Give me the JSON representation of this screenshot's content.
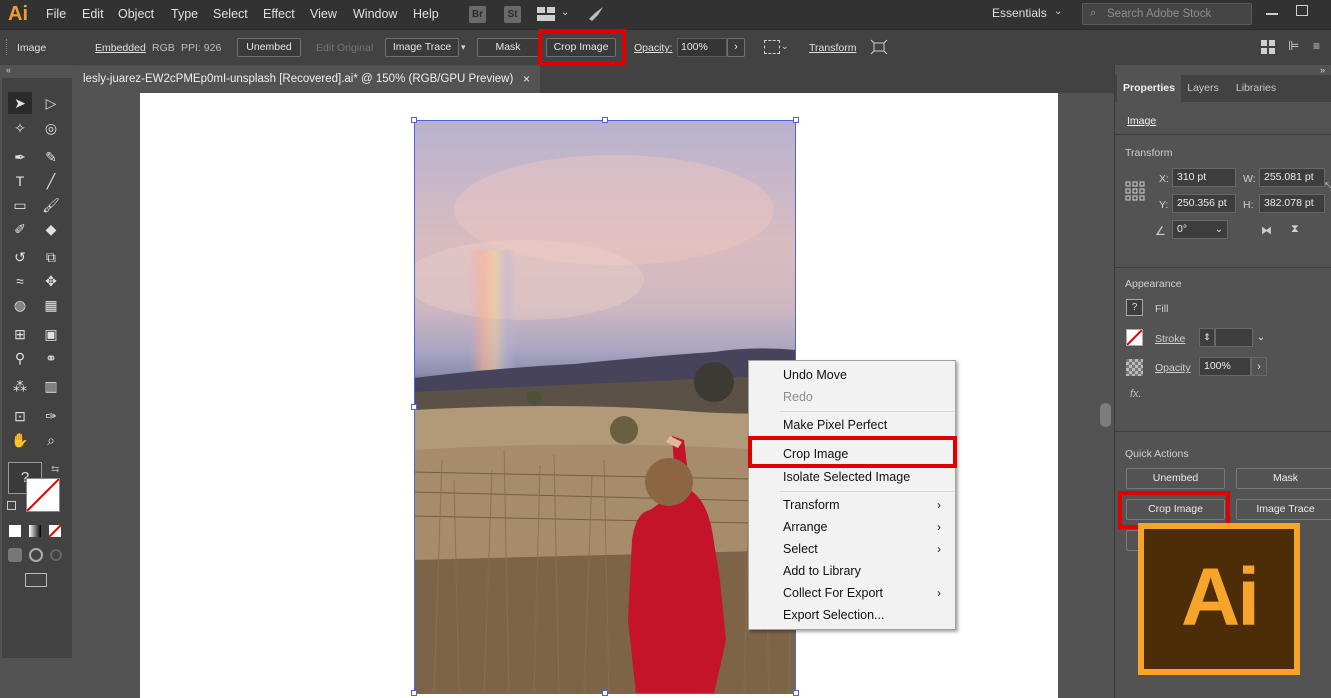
{
  "app": {
    "logo": "Ai"
  },
  "menubar": {
    "items": [
      "File",
      "Edit",
      "Object",
      "Type",
      "Select",
      "Effect",
      "View",
      "Window",
      "Help"
    ],
    "bridge_label": "Br",
    "stock_label": "St",
    "workspace": "Essentials",
    "search_placeholder": "Search Adobe Stock"
  },
  "controlbar": {
    "object_type": "Image",
    "embedded": "Embedded",
    "color_mode": "RGB",
    "ppi": "PPI: 926",
    "unembed": "Unembed",
    "edit_original": "Edit Original",
    "image_trace": "Image Trace",
    "mask": "Mask",
    "crop_image": "Crop Image",
    "opacity_label": "Opacity:",
    "opacity_value": "100%",
    "transform": "Transform"
  },
  "document": {
    "tab_title": "lesly-juarez-EW2cPMEp0mI-unsplash [Recovered].ai* @ 150% (RGB/GPU Preview)",
    "close": "×"
  },
  "context_menu": {
    "items": [
      {
        "label": "Undo Move",
        "disabled": false,
        "submenu": false
      },
      {
        "label": "Redo",
        "disabled": true,
        "submenu": false
      },
      {
        "label": "Make Pixel Perfect",
        "disabled": false,
        "submenu": false
      },
      {
        "label": "Crop Image",
        "disabled": false,
        "submenu": false
      },
      {
        "label": "Isolate Selected Image",
        "disabled": false,
        "submenu": false
      },
      {
        "label": "Transform",
        "disabled": false,
        "submenu": true
      },
      {
        "label": "Arrange",
        "disabled": false,
        "submenu": true
      },
      {
        "label": "Select",
        "disabled": false,
        "submenu": true
      },
      {
        "label": "Add to Library",
        "disabled": false,
        "submenu": false
      },
      {
        "label": "Collect For Export",
        "disabled": false,
        "submenu": true
      },
      {
        "label": "Export Selection...",
        "disabled": false,
        "submenu": false
      }
    ]
  },
  "panel": {
    "tabs": [
      "Properties",
      "Layers",
      "Libraries"
    ],
    "object_type": "Image",
    "transform_title": "Transform",
    "x_label": "X:",
    "x_value": "310 pt",
    "y_label": "Y:",
    "y_value": "250.356 pt",
    "w_label": "W:",
    "w_value": "255.081 pt",
    "h_label": "H:",
    "h_value": "382.078 pt",
    "angle_value": "0°",
    "appearance_title": "Appearance",
    "fill_label": "Fill",
    "stroke_label": "Stroke",
    "opacity_label": "Opacity",
    "opacity_value": "100%",
    "fx_label": "fx.",
    "quick_actions_title": "Quick Actions",
    "qa_unembed": "Unembed",
    "qa_mask": "Mask",
    "qa_crop": "Crop Image",
    "qa_trace": "Image Trace"
  },
  "overlay": {
    "ai_badge": "Ai"
  },
  "colors": {
    "highlight": "#e00000",
    "selection": "#4a66d6",
    "ai_orange": "#f6a42a",
    "ai_brown": "#4c2d07"
  }
}
